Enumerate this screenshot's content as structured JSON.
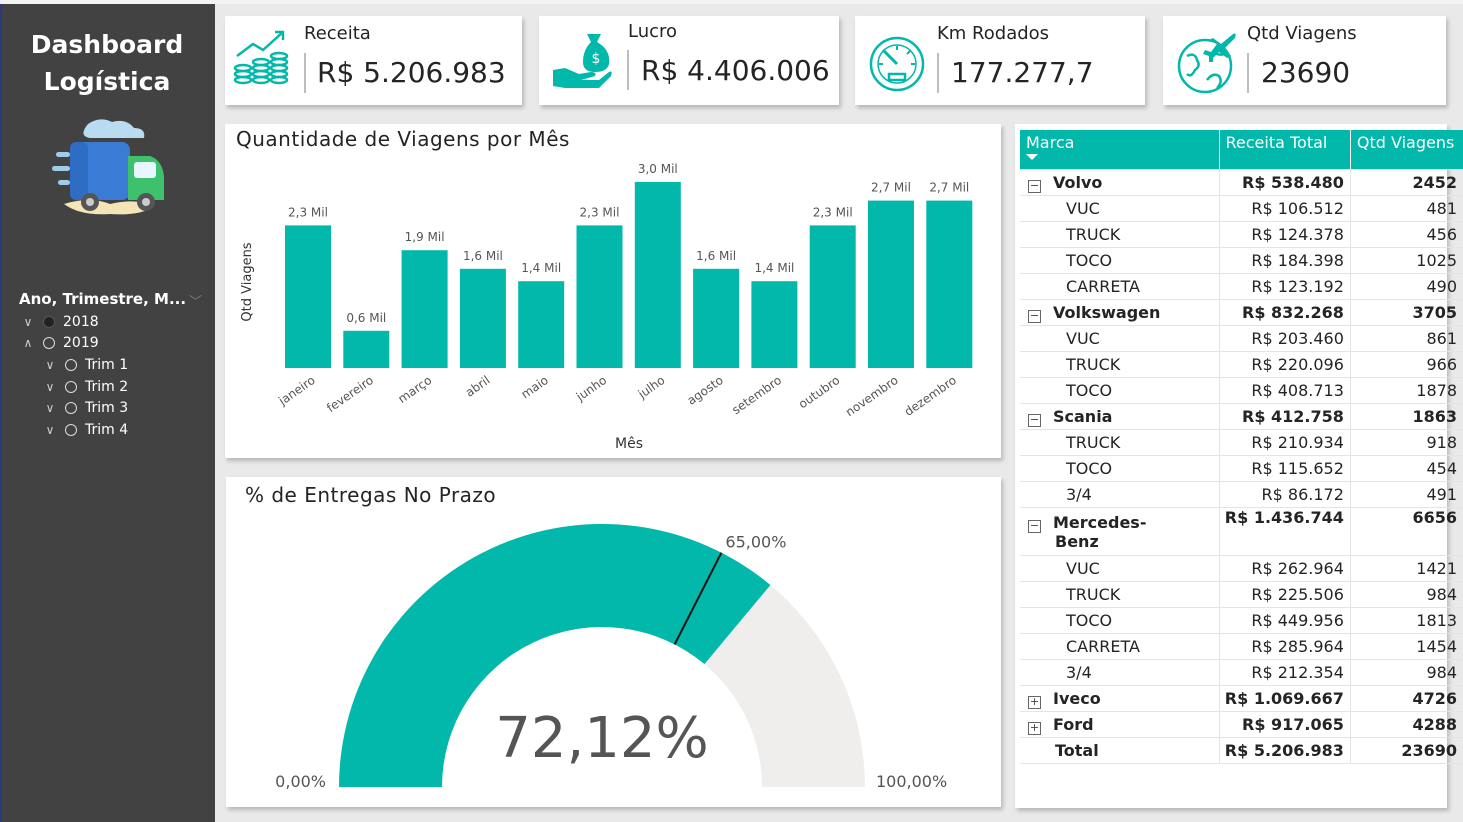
{
  "sidebar": {
    "title_line1": "Dashboard",
    "title_line2": "Logística",
    "slicer_title": "Ano, Trimestre, M...",
    "years": [
      {
        "label": "2018",
        "expanded": false,
        "selected": true
      },
      {
        "label": "2019",
        "expanded": true,
        "selected": false
      }
    ],
    "quarters": [
      "Trim 1",
      "Trim 2",
      "Trim 3",
      "Trim 4"
    ]
  },
  "kpis": [
    {
      "label": "Receita",
      "value": "R$ 5.206.983",
      "icon": "coins-growth-icon"
    },
    {
      "label": "Lucro",
      "value": "R$ 4.406.006",
      "icon": "money-bag-hand-icon"
    },
    {
      "label": "Km Rodados",
      "value": "177.277,7",
      "icon": "speedometer-icon"
    },
    {
      "label": "Qtd Viagens",
      "value": "23690",
      "icon": "globe-plane-icon"
    }
  ],
  "chart_data": [
    {
      "type": "bar",
      "title": "Quantidade de Viagens por Mês",
      "xlabel": "Mês",
      "ylabel": "Qtd Viagens",
      "categories": [
        "janeiro",
        "fevereiro",
        "março",
        "abril",
        "maio",
        "junho",
        "julho",
        "agosto",
        "setembro",
        "outubro",
        "novembro",
        "dezembro"
      ],
      "values": [
        2300,
        600,
        1900,
        1600,
        1400,
        2300,
        3000,
        1600,
        1400,
        2300,
        2700,
        2700
      ],
      "data_labels": [
        "2,3 Mil",
        "0,6 Mil",
        "1,9 Mil",
        "1,6 Mil",
        "1,4 Mil",
        "2,3 Mil",
        "3,0 Mil",
        "1,6 Mil",
        "1,4 Mil",
        "2,3 Mil",
        "2,7 Mil",
        "2,7 Mil"
      ],
      "color": "#01b8aa",
      "ylim": [
        0,
        3000
      ]
    },
    {
      "type": "gauge",
      "title": "% de Entregas No Prazo",
      "value": 72.12,
      "value_label": "72,12%",
      "min": 0,
      "min_label": "0,00%",
      "max": 100,
      "max_label": "100,00%",
      "target": 65,
      "target_label": "65,00%",
      "color": "#01b8aa",
      "track_color": "#efeeed"
    }
  ],
  "matrix": {
    "headers": [
      "Marca",
      "Receita Total",
      "Qtd Viagens"
    ],
    "rows": [
      {
        "type": "brand",
        "expander": "−",
        "name": "Volvo",
        "receita": "R$ 538.480",
        "qtd": "2452"
      },
      {
        "type": "sub",
        "name": "VUC",
        "receita": "R$ 106.512",
        "qtd": "481"
      },
      {
        "type": "sub",
        "name": "TRUCK",
        "receita": "R$ 124.378",
        "qtd": "456"
      },
      {
        "type": "sub",
        "name": "TOCO",
        "receita": "R$ 184.398",
        "qtd": "1025"
      },
      {
        "type": "sub",
        "name": "CARRETA",
        "receita": "R$ 123.192",
        "qtd": "490"
      },
      {
        "type": "brand",
        "expander": "−",
        "name": "Volkswagen",
        "receita": "R$ 832.268",
        "qtd": "3705"
      },
      {
        "type": "sub",
        "name": "VUC",
        "receita": "R$ 203.460",
        "qtd": "861"
      },
      {
        "type": "sub",
        "name": "TRUCK",
        "receita": "R$ 220.096",
        "qtd": "966"
      },
      {
        "type": "sub",
        "name": "TOCO",
        "receita": "R$ 408.713",
        "qtd": "1878"
      },
      {
        "type": "brand",
        "expander": "−",
        "name": "Scania",
        "receita": "R$ 412.758",
        "qtd": "1863"
      },
      {
        "type": "sub",
        "name": "TRUCK",
        "receita": "R$ 210.934",
        "qtd": "918"
      },
      {
        "type": "sub",
        "name": "TOCO",
        "receita": "R$ 115.652",
        "qtd": "454"
      },
      {
        "type": "sub",
        "name": "3/4",
        "receita": "R$ 86.172",
        "qtd": "491"
      },
      {
        "type": "brand2",
        "expander": "−",
        "name": "Mercedes-",
        "name2": "Benz",
        "receita": "R$ 1.436.744",
        "qtd": "6656"
      },
      {
        "type": "sub",
        "name": "VUC",
        "receita": "R$ 262.964",
        "qtd": "1421"
      },
      {
        "type": "sub",
        "name": "TRUCK",
        "receita": "R$ 225.506",
        "qtd": "984"
      },
      {
        "type": "sub",
        "name": "TOCO",
        "receita": "R$ 449.956",
        "qtd": "1813"
      },
      {
        "type": "sub",
        "name": "CARRETA",
        "receita": "R$ 285.964",
        "qtd": "1454"
      },
      {
        "type": "sub",
        "name": "3/4",
        "receita": "R$ 212.354",
        "qtd": "984"
      },
      {
        "type": "brand",
        "expander": "+",
        "name": "Iveco",
        "receita": "R$ 1.069.667",
        "qtd": "4726"
      },
      {
        "type": "brand",
        "expander": "+",
        "name": "Ford",
        "receita": "R$ 917.065",
        "qtd": "4288"
      },
      {
        "type": "total",
        "name": "Total",
        "receita": "R$ 5.206.983",
        "qtd": "23690"
      }
    ]
  },
  "colors": {
    "accent": "#01b8aa",
    "sidebar": "#424242"
  }
}
